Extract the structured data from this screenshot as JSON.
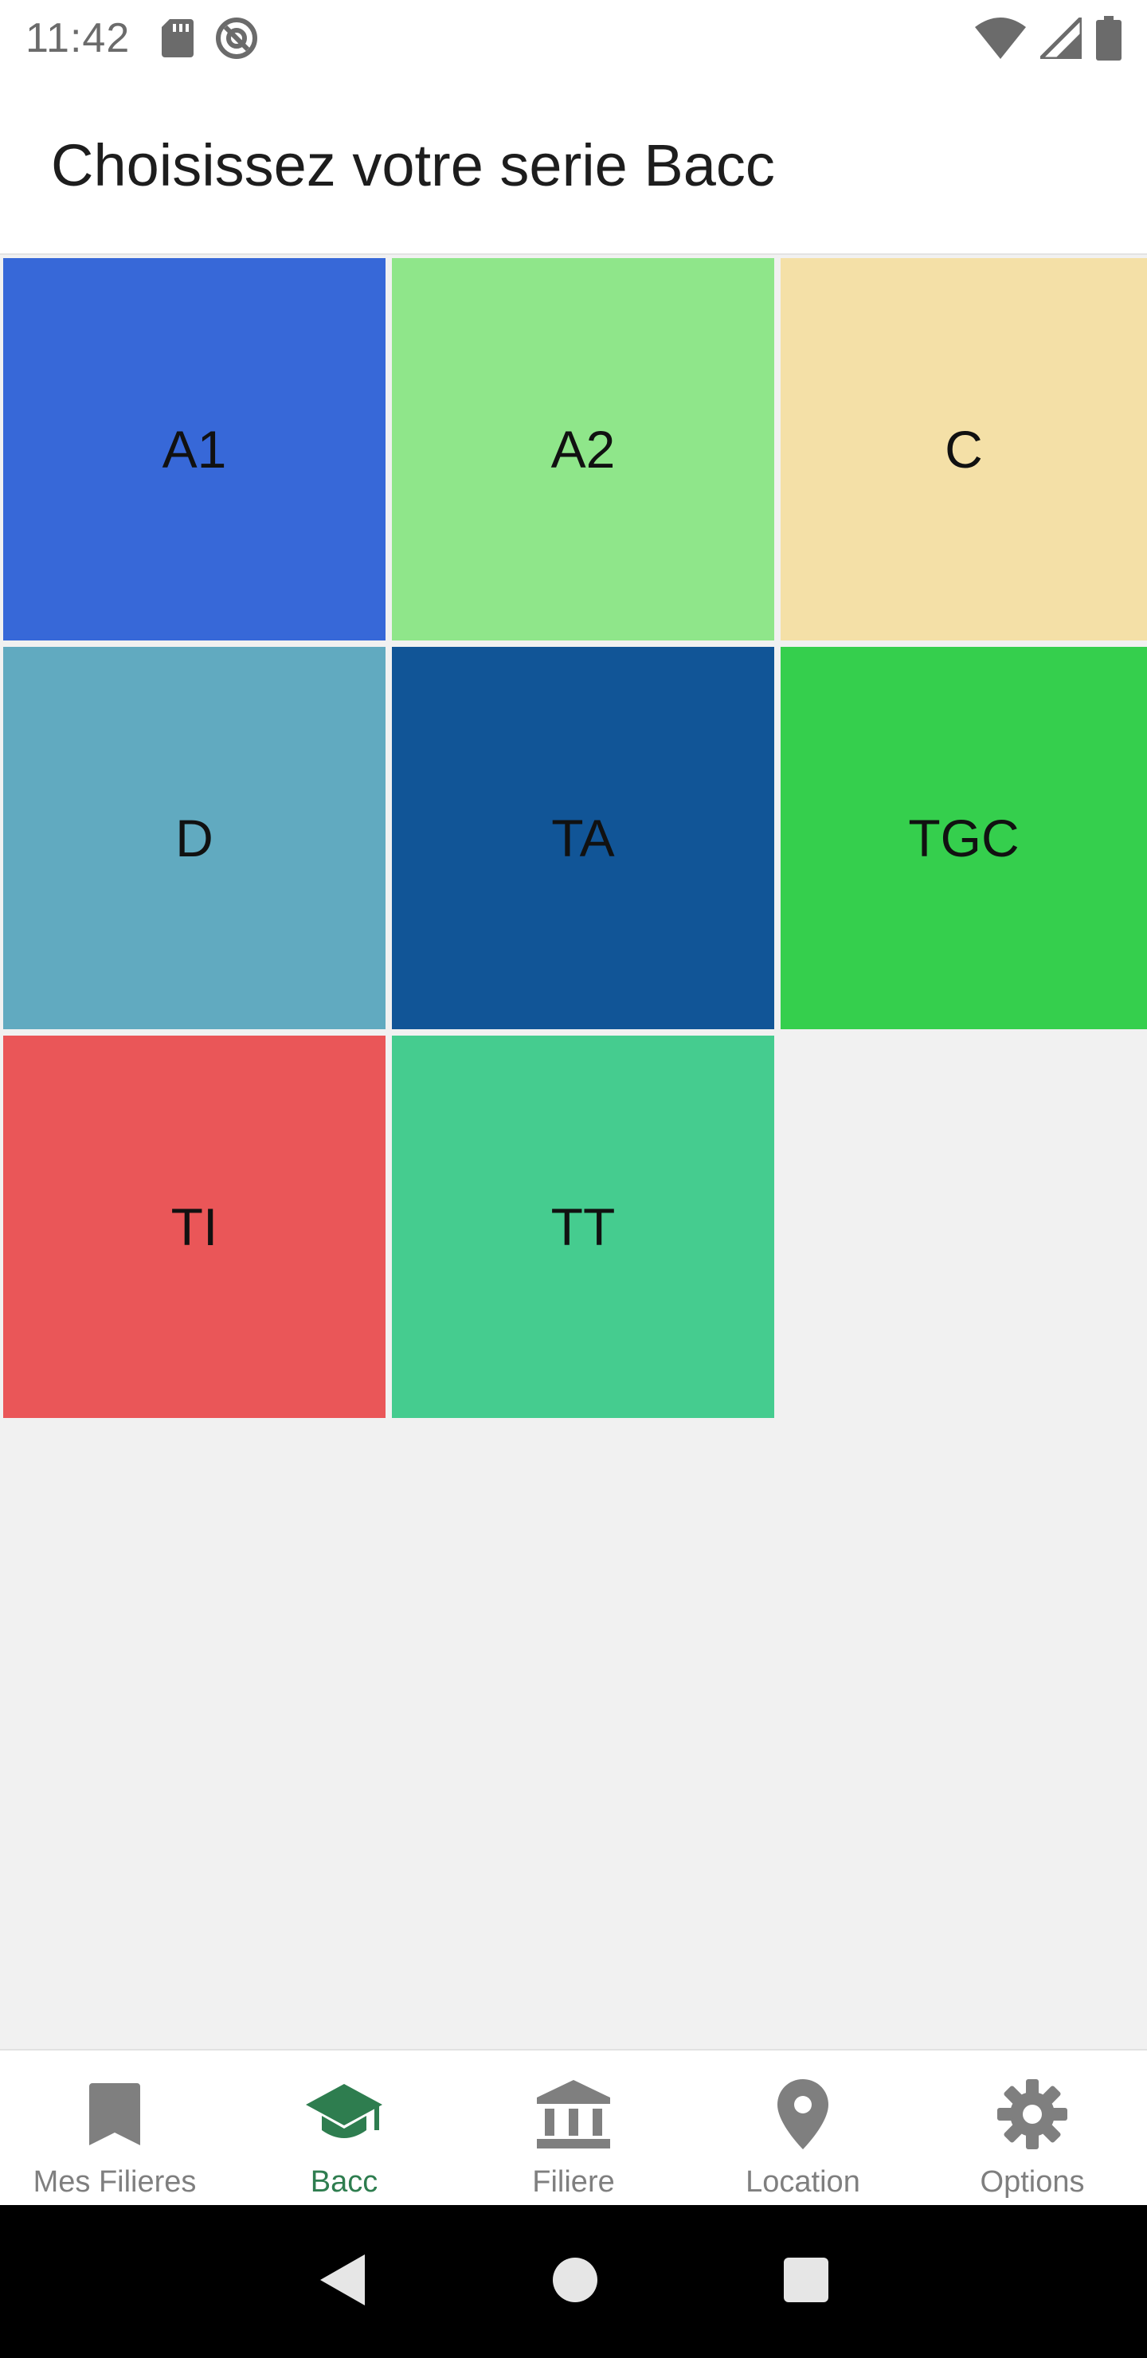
{
  "status_bar": {
    "time": "11:42",
    "icons": [
      "sd-card-icon",
      "do-not-disturb-icon",
      "wifi-icon",
      "signal-icon",
      "battery-icon"
    ]
  },
  "header": {
    "title": "Choisissez votre serie Bacc"
  },
  "tiles": [
    {
      "label": "A1",
      "color": "#3768d8"
    },
    {
      "label": "A2",
      "color": "#8fe68a"
    },
    {
      "label": "C",
      "color": "#f4e0a7"
    },
    {
      "label": "D",
      "color": "#61aac0"
    },
    {
      "label": "TA",
      "color": "#115597"
    },
    {
      "label": "TGC",
      "color": "#35cf4d"
    },
    {
      "label": "TI",
      "color": "#ea5658"
    },
    {
      "label": "TT",
      "color": "#45cc8f"
    }
  ],
  "bottom_nav": {
    "active_color": "#2e7d4f",
    "inactive_color": "#7f7f7f",
    "items": [
      {
        "label": "Mes Filieres",
        "icon": "bookmark-icon"
      },
      {
        "label": "Bacc",
        "icon": "graduation-cap-icon",
        "active": true
      },
      {
        "label": "Filiere",
        "icon": "institution-icon"
      },
      {
        "label": "Location",
        "icon": "location-pin-icon"
      },
      {
        "label": "Options",
        "icon": "gear-icon"
      }
    ]
  }
}
